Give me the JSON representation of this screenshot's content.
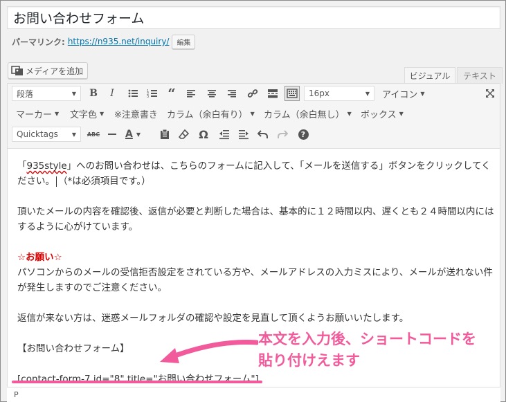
{
  "post": {
    "title": "お問い合わせフォーム"
  },
  "permalink": {
    "label": "パーマリンク:",
    "url": "https://n935.net/inquiry/",
    "edit_label": "編集"
  },
  "media": {
    "add_label": "メディアを追加"
  },
  "tabs": [
    {
      "label": "ビジュアル",
      "active": true
    },
    {
      "label": "テキスト",
      "active": false
    }
  ],
  "toolbar": {
    "format_select": "段落",
    "font_size_select": "16px",
    "icon_menu": "アイコン",
    "row2_menus": [
      "マーカー",
      "文字色",
      "※注意書き",
      "カラム（余白有り）",
      "カラム（余白無し）",
      "ボックス"
    ],
    "quicktags_select": "Quicktags",
    "abc": "ABC",
    "omega": "Ω",
    "help": "?"
  },
  "content": {
    "p1_part1": "「",
    "p1_brand": "935style",
    "p1_part2": "」へのお問い合わせは、こちらのフォームに記入して、「メールを送信する」ボタンをクリックしてください。",
    "p1_part3": "（*は必須項目です。）",
    "p2": "頂いたメールの内容を確認後、返信が必要と判断した場合は、基本的に１２時間以内、遅くとも２４時間以内にはするように心がけています。",
    "p3_heading": "☆お願い☆",
    "p3": "パソコンからのメールの受信拒否設定をされている方や、メールアドレスの入力ミスにより、メールが送れない件が発生しますのでご注意ください。",
    "p4": "返信が来ない方は、迷惑メールフォルダの確認や設定を見直して頂くようお願いいたします。",
    "p5": "【お問い合わせフォーム】",
    "shortcode": "[contact-form-7 id=\"8\" title=\"お問い合わせフォーム\"]"
  },
  "annotation": {
    "line1": "本文を入力後、ショートコードを",
    "line2": "貼り付けえます",
    "color": "#f25b9b"
  },
  "statusbar": {
    "path": "P"
  }
}
